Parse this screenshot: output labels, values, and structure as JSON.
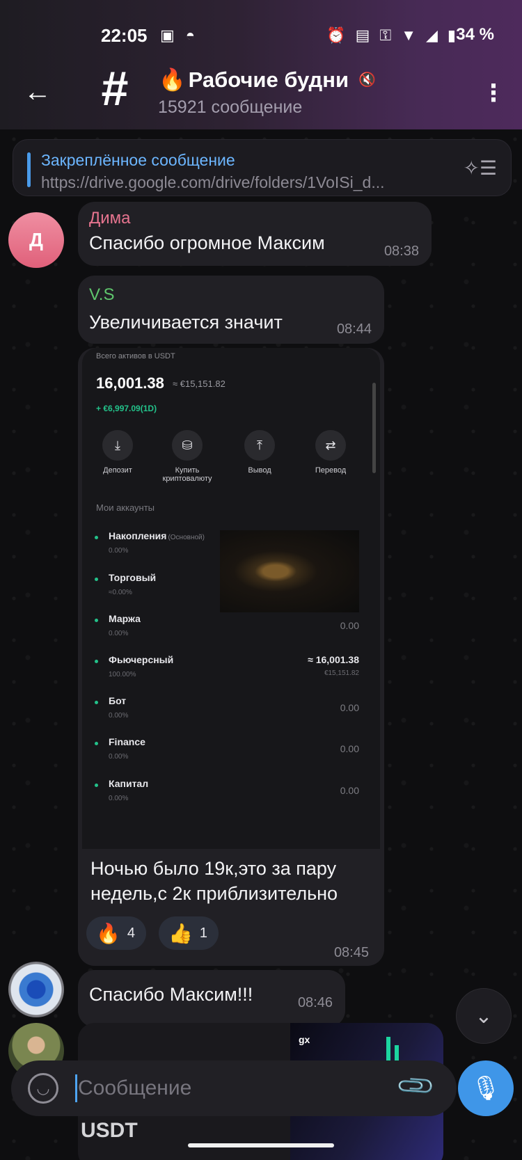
{
  "status_bar": {
    "time": "22:05",
    "battery": "34 %",
    "left_icons": [
      "image-icon",
      "incognito-icon"
    ],
    "right_icons": [
      "alarm-icon",
      "auto-hz-icon",
      "key-icon",
      "wifi-icon",
      "signal-icon",
      "battery-icon"
    ]
  },
  "header": {
    "back_icon": "arrow-left-icon",
    "channel_icon": "hashtag-icon",
    "title_emoji": "🔥",
    "title": "Рабочие будни",
    "muted_icon": "mute-icon",
    "subtitle": "15921 сообщение",
    "more_icon": "more-vertical-icon",
    "accent_color": "#4e2a5c"
  },
  "pinned": {
    "title": "Закреплённое сообщение",
    "text": "https://drive.google.com/drive/folders/1VoISi_d...",
    "icon": "pin-list-icon"
  },
  "messages": [
    {
      "avatar_letter": "Д",
      "sender": "Дима",
      "sender_color": "#e6748f",
      "text": "Спасибо огромное Максим",
      "time": "08:38"
    },
    {
      "sender": "V.S",
      "sender_color": "#5fc66d",
      "text": "Увеличивается значит",
      "time": "08:44"
    },
    {
      "screenshot": {
        "assets_label": "Всего активов в USDT",
        "balance": "16,001.38",
        "balance_eur": "≈ €15,151.82",
        "pnl": "+ €6,997.09(1D)",
        "actions": [
          {
            "label": "Депозит",
            "icon": "deposit-icon"
          },
          {
            "label": "Купить криптовалюту",
            "icon": "buy-crypto-icon"
          },
          {
            "label": "Вывод",
            "icon": "withdraw-icon"
          },
          {
            "label": "Перевод",
            "icon": "transfer-icon"
          }
        ],
        "accounts_title": "Мои аккаунты",
        "accounts": [
          {
            "name": "Накопления",
            "tag": "(Основной)",
            "pct": "0.00%",
            "value": ""
          },
          {
            "name": "Торговый",
            "tag": "",
            "pct": "≈0.00%",
            "value": ""
          },
          {
            "name": "Маржа",
            "tag": "",
            "pct": "0.00%",
            "value": "0.00"
          },
          {
            "name": "Фьючерсный",
            "tag": "",
            "pct": "100.00%",
            "value": "≈ 16,001.38",
            "sub": "€15,151.82"
          },
          {
            "name": "Бот",
            "tag": "",
            "pct": "0.00%",
            "value": "0.00"
          },
          {
            "name": "Finance",
            "tag": "",
            "pct": "0.00%",
            "value": "0.00"
          },
          {
            "name": "Капитал",
            "tag": "",
            "pct": "0.00%",
            "value": "0.00"
          }
        ]
      },
      "text": "Ночью было 19к,это за пару недель,с 2к приблизительно",
      "reactions": [
        {
          "emoji": "🔥",
          "count": "4"
        },
        {
          "emoji": "👍",
          "count": "1"
        }
      ],
      "time": "08:45"
    },
    {
      "text": "Спасибо Максим!!!",
      "time": "08:46"
    },
    {
      "text": "-",
      "preview_text": "USDT",
      "preview_logo": "gx"
    }
  ],
  "composer": {
    "placeholder": "Сообщение",
    "emoji_icon": "emoji-icon",
    "attach_icon": "attach-icon",
    "mic_icon": "microphone-icon"
  },
  "scroll_down_icon": "chevron-down-icon"
}
